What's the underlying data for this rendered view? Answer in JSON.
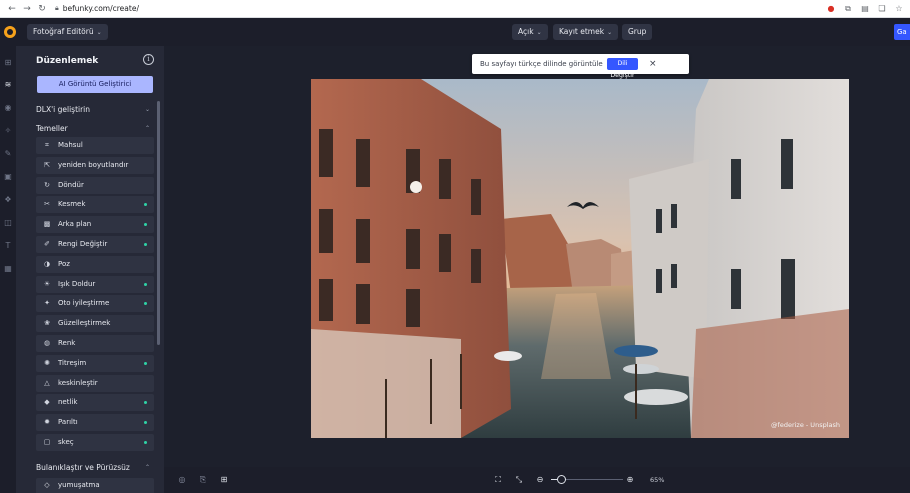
{
  "browser": {
    "url": "befunky.com/create/",
    "back_icon": "back-arrow-icon",
    "forward_icon": "forward-arrow-icon",
    "reload_icon": "reload-icon"
  },
  "header": {
    "editor_menu": "Fotoğraf Editörü",
    "open_menu": "Açık",
    "save_menu": "Kayıt etmek",
    "group_button": "Grup",
    "save_cut": "Ga"
  },
  "panel": {
    "title": "Düzenlemek",
    "ai_button": "AI Görüntü Geliştirici",
    "section_dlx": "DLX'i geliştirin",
    "section_basics": "Temeller",
    "section_blur": "Bulanıklaştır ve Pürüzsüz",
    "tools": [
      {
        "label": "Mahsul",
        "icon": "crop-icon",
        "dot": false
      },
      {
        "label": "yeniden boyutlandır",
        "icon": "resize-icon",
        "dot": false
      },
      {
        "label": "Döndür",
        "icon": "rotate-icon",
        "dot": false
      },
      {
        "label": "Kesmek",
        "icon": "cutout-icon",
        "dot": true
      },
      {
        "label": "Arka plan",
        "icon": "background-icon",
        "dot": true
      },
      {
        "label": "Rengi Değiştir",
        "icon": "color-change-icon",
        "dot": true
      },
      {
        "label": "Poz",
        "icon": "exposure-icon",
        "dot": false
      },
      {
        "label": "Işık Doldur",
        "icon": "fill-light-icon",
        "dot": true
      },
      {
        "label": "Oto iyileştirme",
        "icon": "auto-enhance-icon",
        "dot": true
      },
      {
        "label": "Güzelleştirmek",
        "icon": "beautify-icon",
        "dot": false
      },
      {
        "label": "Renk",
        "icon": "color-icon",
        "dot": false
      },
      {
        "label": "Titreşim",
        "icon": "vibrance-icon",
        "dot": true
      },
      {
        "label": "keskinleştir",
        "icon": "sharpen-icon",
        "dot": false
      },
      {
        "label": "netlik",
        "icon": "clarity-icon",
        "dot": true
      },
      {
        "label": "Parıltı",
        "icon": "glow-icon",
        "dot": true
      },
      {
        "label": "skeç",
        "icon": "sketch-icon",
        "dot": true
      }
    ],
    "blur_tool": "yumuşatma"
  },
  "canvas": {
    "lang_prompt": "Bu sayfayı türkçe dilinde görüntüle",
    "lang_button": "Dili Değiştir",
    "photo_credit": "@federize - Unsplash",
    "zoom_percent": "65%"
  },
  "colors": {
    "accent": "#3557ff",
    "ai_button": "#aab6ff",
    "new_dot": "#2fd3a6"
  }
}
